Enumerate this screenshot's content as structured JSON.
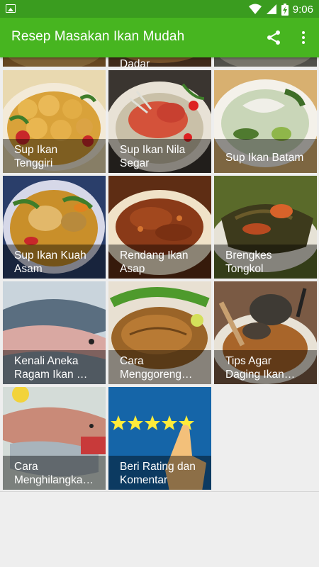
{
  "status_bar": {
    "time": "9:06",
    "icons": [
      "image-notification-icon",
      "wifi-icon",
      "signal-icon",
      "battery-charging-icon"
    ]
  },
  "app_bar": {
    "title": "Resep Masakan Ikan Mudah",
    "icons": [
      "share-icon",
      "more-vert-icon"
    ]
  },
  "colors": {
    "status_bar": "#3a9c1f",
    "app_bar": "#47b520",
    "background": "#eeeeee",
    "rating_tile": "#1565a8",
    "star": "#ffeb3b"
  },
  "top_partial_tiles": [
    "Dadar"
  ],
  "tiles": [
    {
      "label": "Sup Ikan\nTenggiri"
    },
    {
      "label": "Sup Ikan Nila\nSegar"
    },
    {
      "label": "Sup Ikan Batam"
    },
    {
      "label": "Sup Ikan Kuah\nAsam"
    },
    {
      "label": "Rendang Ikan\nAsap"
    },
    {
      "label": "Brengkes\nTongkol"
    },
    {
      "label": "Kenali Aneka\nRagam Ikan …"
    },
    {
      "label": "Cara\nMenggoreng…"
    },
    {
      "label": "Tips Agar\nDaging Ikan…"
    },
    {
      "label": "Cara\nMenghilangka…"
    },
    {
      "label": "Beri Rating dan\nKomentar"
    }
  ]
}
